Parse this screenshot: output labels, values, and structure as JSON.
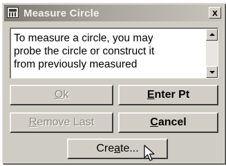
{
  "window": {
    "title": "Measure Circle",
    "close_glyph": "x",
    "app_icon": "calculator-icon"
  },
  "message": {
    "lines": [
      "To measure a circle, you may",
      "probe the circle or construct it",
      "from previously measured"
    ]
  },
  "buttons": {
    "ok": {
      "pre": "",
      "accel": "O",
      "post": "k",
      "enabled": false
    },
    "enter_pt": {
      "pre": "",
      "accel": "E",
      "post": "nter Pt",
      "enabled": true
    },
    "remove_last": {
      "pre": "",
      "accel": "R",
      "post": "emove Last",
      "enabled": false
    },
    "cancel": {
      "pre": "",
      "accel": "C",
      "post": "ancel",
      "enabled": true
    },
    "create": {
      "pre": "Cre",
      "accel": "a",
      "post": "te...",
      "enabled": true
    }
  },
  "cursor": "arrow-cursor-icon"
}
